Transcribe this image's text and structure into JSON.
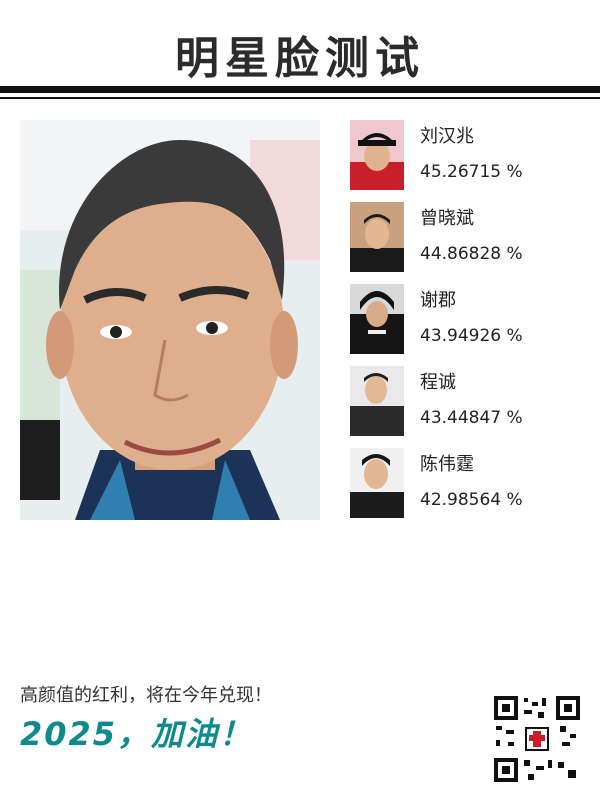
{
  "title": "明星脸测试",
  "matches": [
    {
      "name": "刘汉兆",
      "score": "45.26715 %"
    },
    {
      "name": "曾晓斌",
      "score": "44.86828 %"
    },
    {
      "name": "谢郡",
      "score": "43.94926 %"
    },
    {
      "name": "程诚",
      "score": "43.44847 %"
    },
    {
      "name": "陈伟霆",
      "score": "42.98564 %"
    }
  ],
  "footer": {
    "line1": "高颜值的红利，将在今年兑现！",
    "line2": "2025，加油！"
  },
  "colors": {
    "accent": "#0f8a8c",
    "rule": "#111111",
    "title": "#2b2b2b"
  },
  "icons": {
    "qr": "qr-code-icon"
  }
}
